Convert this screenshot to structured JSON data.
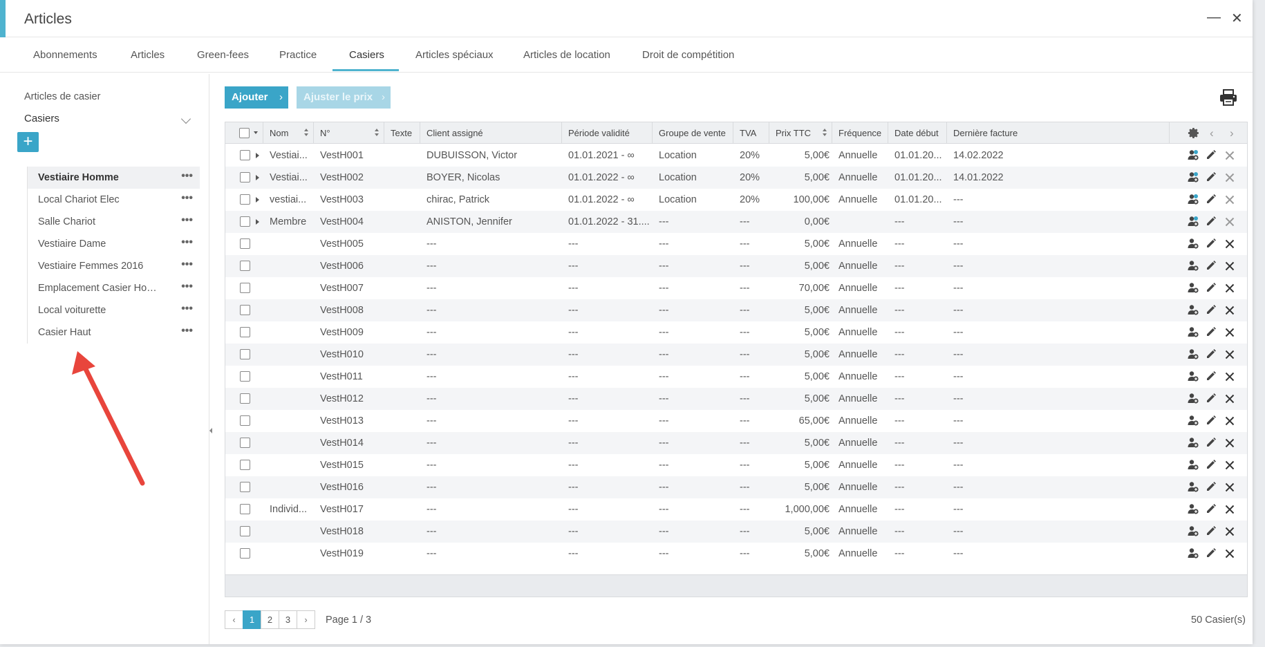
{
  "window": {
    "title": "Articles",
    "minimize": "—",
    "close": "✕"
  },
  "tabs": [
    "Abonnements",
    "Articles",
    "Green-fees",
    "Practice",
    "Casiers",
    "Articles spéciaux",
    "Articles de location",
    "Droit de compétition"
  ],
  "active_tab": "Casiers",
  "sidebar": {
    "section_title": "Articles de casier",
    "group_title": "Casiers",
    "add_label": "+",
    "items": [
      {
        "label": "Vestiaire Homme",
        "selected": true
      },
      {
        "label": "Local Chariot Elec"
      },
      {
        "label": "Salle Chariot"
      },
      {
        "label": "Vestiaire Dame"
      },
      {
        "label": "Vestiaire Femmes 2016"
      },
      {
        "label": "Emplacement Casier Hom..."
      },
      {
        "label": "Local voiturette"
      },
      {
        "label": "Casier Haut"
      }
    ],
    "more_label": "•••"
  },
  "toolbar": {
    "add": "Ajouter",
    "adjust_price": "Ajuster le prix",
    "chevron": "›"
  },
  "table": {
    "headers": {
      "nom": "Nom",
      "no": "N°",
      "texte": "Texte",
      "client": "Client assigné",
      "periode": "Période validité",
      "groupe": "Groupe de vente",
      "tva": "TVA",
      "prix": "Prix TTC",
      "frequence": "Fréquence",
      "date_debut": "Date début",
      "derniere_facture": "Dernière facture"
    },
    "rows": [
      {
        "nom": "Vestiai...",
        "no": "VestH001",
        "texte": "",
        "client": "DUBUISSON, Victor",
        "periode": "01.01.2021 - ∞",
        "groupe": "Location",
        "tva": "20%",
        "prix": "5,00€",
        "freq": "Annuelle",
        "debut": "01.01.20...",
        "facture": "14.02.2022",
        "expand": true,
        "assigned": true
      },
      {
        "nom": "Vestiai...",
        "no": "VestH002",
        "texte": "",
        "client": "BOYER, Nicolas",
        "periode": "01.01.2022 - ∞",
        "groupe": "Location",
        "tva": "20%",
        "prix": "5,00€",
        "freq": "Annuelle",
        "debut": "01.01.20...",
        "facture": "14.01.2022",
        "expand": true,
        "assigned": true
      },
      {
        "nom": "vestiai...",
        "no": "VestH003",
        "texte": "",
        "client": "chirac, Patrick",
        "periode": "01.01.2022 - ∞",
        "groupe": "Location",
        "tva": "20%",
        "prix": "100,00€",
        "freq": "Annuelle",
        "debut": "01.01.20...",
        "facture": "---",
        "expand": true,
        "assigned": true
      },
      {
        "nom": "Membre",
        "no": "VestH004",
        "texte": "",
        "client": "ANISTON, Jennifer",
        "periode": "01.01.2022 - 31....",
        "groupe": "---",
        "tva": "---",
        "prix": "0,00€",
        "freq": "",
        "debut": "---",
        "facture": "---",
        "expand": true,
        "assigned": true
      },
      {
        "nom": "",
        "no": "VestH005",
        "texte": "",
        "client": "---",
        "periode": "---",
        "groupe": "---",
        "tva": "---",
        "prix": "5,00€",
        "freq": "Annuelle",
        "debut": "---",
        "facture": "---"
      },
      {
        "nom": "",
        "no": "VestH006",
        "texte": "",
        "client": "---",
        "periode": "---",
        "groupe": "---",
        "tva": "---",
        "prix": "5,00€",
        "freq": "Annuelle",
        "debut": "---",
        "facture": "---"
      },
      {
        "nom": "",
        "no": "VestH007",
        "texte": "",
        "client": "---",
        "periode": "---",
        "groupe": "---",
        "tva": "---",
        "prix": "70,00€",
        "freq": "Annuelle",
        "debut": "---",
        "facture": "---"
      },
      {
        "nom": "",
        "no": "VestH008",
        "texte": "",
        "client": "---",
        "periode": "---",
        "groupe": "---",
        "tva": "---",
        "prix": "5,00€",
        "freq": "Annuelle",
        "debut": "---",
        "facture": "---"
      },
      {
        "nom": "",
        "no": "VestH009",
        "texte": "",
        "client": "---",
        "periode": "---",
        "groupe": "---",
        "tva": "---",
        "prix": "5,00€",
        "freq": "Annuelle",
        "debut": "---",
        "facture": "---"
      },
      {
        "nom": "",
        "no": "VestH010",
        "texte": "",
        "client": "---",
        "periode": "---",
        "groupe": "---",
        "tva": "---",
        "prix": "5,00€",
        "freq": "Annuelle",
        "debut": "---",
        "facture": "---"
      },
      {
        "nom": "",
        "no": "VestH011",
        "texte": "",
        "client": "---",
        "periode": "---",
        "groupe": "---",
        "tva": "---",
        "prix": "5,00€",
        "freq": "Annuelle",
        "debut": "---",
        "facture": "---"
      },
      {
        "nom": "",
        "no": "VestH012",
        "texte": "",
        "client": "---",
        "periode": "---",
        "groupe": "---",
        "tva": "---",
        "prix": "5,00€",
        "freq": "Annuelle",
        "debut": "---",
        "facture": "---"
      },
      {
        "nom": "",
        "no": "VestH013",
        "texte": "",
        "client": "---",
        "periode": "---",
        "groupe": "---",
        "tva": "---",
        "prix": "65,00€",
        "freq": "Annuelle",
        "debut": "---",
        "facture": "---"
      },
      {
        "nom": "",
        "no": "VestH014",
        "texte": "",
        "client": "---",
        "periode": "---",
        "groupe": "---",
        "tva": "---",
        "prix": "5,00€",
        "freq": "Annuelle",
        "debut": "---",
        "facture": "---"
      },
      {
        "nom": "",
        "no": "VestH015",
        "texte": "",
        "client": "---",
        "periode": "---",
        "groupe": "---",
        "tva": "---",
        "prix": "5,00€",
        "freq": "Annuelle",
        "debut": "---",
        "facture": "---"
      },
      {
        "nom": "",
        "no": "VestH016",
        "texte": "",
        "client": "---",
        "periode": "---",
        "groupe": "---",
        "tva": "---",
        "prix": "5,00€",
        "freq": "Annuelle",
        "debut": "---",
        "facture": "---"
      },
      {
        "nom": "Individ...",
        "no": "VestH017",
        "texte": "",
        "client": "---",
        "periode": "---",
        "groupe": "---",
        "tva": "---",
        "prix": "1,000,00€",
        "freq": "Annuelle",
        "debut": "---",
        "facture": "---"
      },
      {
        "nom": "",
        "no": "VestH018",
        "texte": "",
        "client": "---",
        "periode": "---",
        "groupe": "---",
        "tva": "---",
        "prix": "5,00€",
        "freq": "Annuelle",
        "debut": "---",
        "facture": "---"
      },
      {
        "nom": "",
        "no": "VestH019",
        "texte": "",
        "client": "---",
        "periode": "---",
        "groupe": "---",
        "tva": "---",
        "prix": "5,00€",
        "freq": "Annuelle",
        "debut": "---",
        "facture": "---"
      }
    ]
  },
  "pagination": {
    "prev": "‹",
    "next": "›",
    "pages": [
      "1",
      "2",
      "3"
    ],
    "current": "1",
    "label": "Page 1 / 3"
  },
  "total_label": "50 Casier(s)",
  "colors": {
    "accent": "#3aa5c8",
    "annotation_arrow": "#e8453c"
  },
  "icons": [
    "minimize-icon",
    "close-icon",
    "chevron-down-icon",
    "print-icon",
    "settings-gear-icon",
    "assign-user-icon",
    "edit-pencil-icon",
    "delete-x-icon"
  ]
}
